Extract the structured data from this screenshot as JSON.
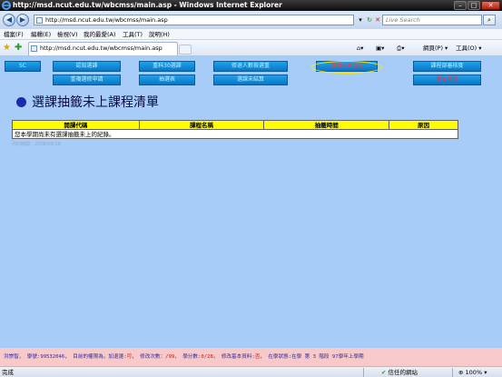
{
  "window": {
    "title": "http://msd.ncut.edu.tw/wbcmss/main.asp - Windows Internet Explorer",
    "min": "–",
    "max": "□",
    "close": "✕"
  },
  "address": {
    "url": "http://msd.ncut.edu.tw/wbcmss/main.asp",
    "search_placeholder": "Live Search"
  },
  "menu": [
    "檔案(F)",
    "編輯(E)",
    "檢視(V)",
    "我的最愛(A)",
    "工具(T)",
    "說明(H)"
  ],
  "tab": {
    "label": "http://msd.ncut.edu.tw/wbcmss/main.asp"
  },
  "tools": {
    "page": "網頁(P) ▾",
    "tools": "工具(O) ▾"
  },
  "nav": {
    "row1": [
      "SC",
      "認知選課",
      "重科30選課",
      "修退人數檢選重",
      "選課結果查詢",
      "課程部審核度"
    ],
    "row2": [
      "重複選修申請",
      "抽選表",
      "選課未結算",
      "登出系統"
    ]
  },
  "page": {
    "heading": "選課抽籤未上課程清單",
    "columns": [
      "開課代碼",
      "課程名稱",
      "抽籤時間",
      "原因"
    ],
    "empty_message": "您本學期尚未有選課抽籤未上的紀錄。",
    "note": "列印時間：2008/09/18"
  },
  "info": {
    "name": "洪崇智",
    "student_id_label": "學號:",
    "student_id": "99532046",
    "authority_text": "目前的權限為，加退選:",
    "authority_value": "可",
    "credits_label": "修改次數：",
    "credits_value": "/99",
    "score_label": "學分數:",
    "score_value": "0/28",
    "basic_label": "修改基本資料:",
    "basic_value": "否",
    "status_text": "在學狀態:在學 第 3 階段 97學年上學期"
  },
  "status": {
    "left": "完成",
    "zone": "信任的網站",
    "zoom": "100%"
  },
  "colors": {
    "content_bg": "#a8ccf8",
    "nav_button": "#1590dc",
    "header_yellow": "#ffff00",
    "heading_bullet": "#1a2bb0",
    "info_bar": "#f7c9c9"
  }
}
